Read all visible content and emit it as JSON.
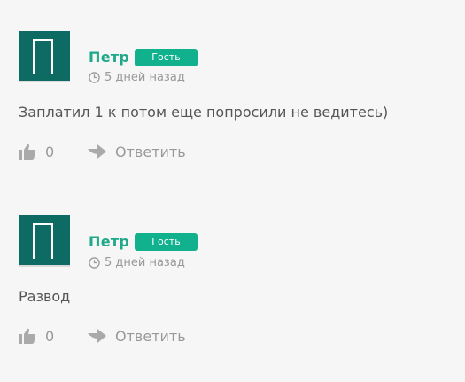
{
  "comments": [
    {
      "author": "Петр",
      "badge": "Гость",
      "time": "5 дней назад",
      "text": "Заплатил 1 к потом еще попросили не ведитесь)",
      "likes": "0",
      "reply_label": "Ответить"
    },
    {
      "author": "Петр",
      "badge": "Гость",
      "time": "5 дней назад",
      "text": "Развод",
      "likes": "0",
      "reply_label": "Ответить"
    }
  ],
  "colors": {
    "avatar": "#0d6b63",
    "author": "#1fa88a",
    "badge": "#11b18d",
    "background": "#f6f6f6"
  },
  "icons": {
    "clock": "clock-icon",
    "like": "thumbs-up-icon",
    "reply": "reply-arrow-icon"
  }
}
